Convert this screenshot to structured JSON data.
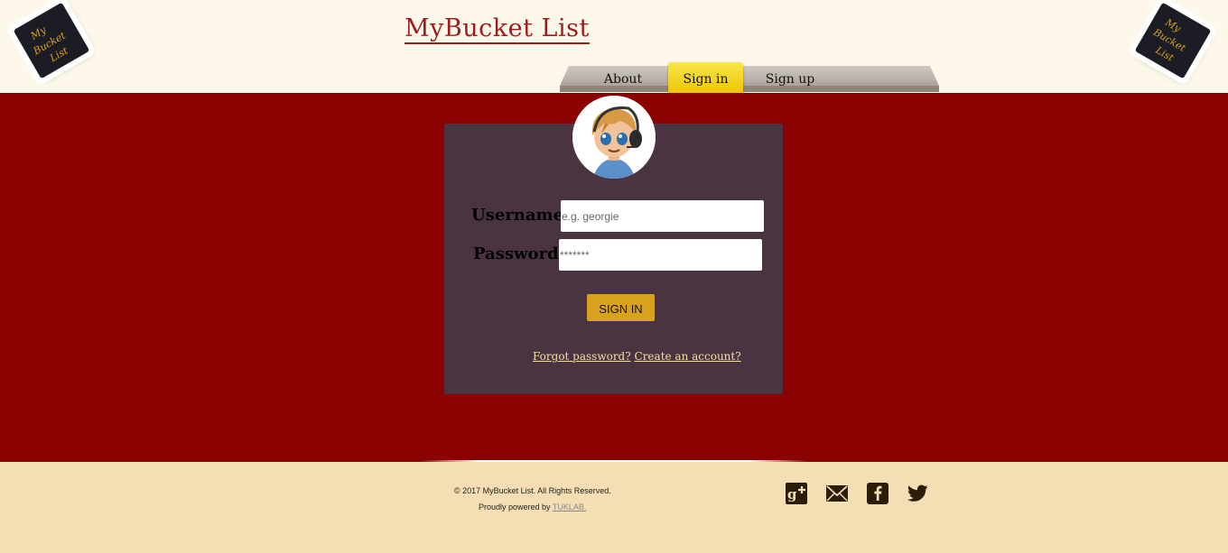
{
  "header": {
    "title": "MyBucket List",
    "logo_text": "My Bucket List"
  },
  "nav": {
    "items": [
      {
        "label": "About"
      },
      {
        "label": "Sign in"
      },
      {
        "label": "Sign up"
      }
    ],
    "active_color": "#f0c400"
  },
  "login": {
    "username_label": "Username:",
    "username_placeholder": "e.g. georgie",
    "password_label": "Password:",
    "password_placeholder": "*******",
    "submit_label": "SIGN IN",
    "forgot_link": "Forgot password?",
    "create_link": "Create an account?"
  },
  "footer": {
    "copyright": "© 2017 MyBucket List. All Rights Reserved.",
    "powered_prefix": "Proudly powered by",
    "powered_link": "TUKLAB.",
    "social": [
      "google-plus-icon",
      "mail-icon",
      "facebook-icon",
      "twitter-icon"
    ]
  },
  "colors": {
    "main_bg": "#8b0000",
    "card_bg": "#4b3442",
    "footer_bg": "#f5deb3",
    "button": "#d9a21c",
    "title": "#9b1c1c"
  }
}
